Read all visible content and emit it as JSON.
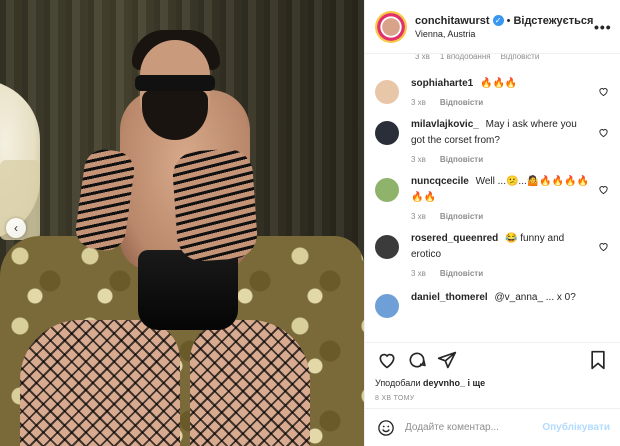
{
  "header": {
    "username": "conchitawurst",
    "separator": "•",
    "follow_status": "Відстежується",
    "location": "Vienna, Austria",
    "more_label": "•••"
  },
  "partial_row": {
    "time": "3 хв",
    "likes": "1 вподобання",
    "reply": "Відповісти"
  },
  "comments": [
    {
      "user": "sophiaharte1",
      "text": "🔥🔥🔥",
      "time": "3 хв",
      "reply": "Відповісти",
      "avatar_color": "#e8c6a8"
    },
    {
      "user": "milavlajkovic_",
      "text": "May i ask where you got the corset from?",
      "time": "3 хв",
      "reply": "Відповісти",
      "avatar_color": "#2a2e38"
    },
    {
      "user": "nuncqcecile",
      "text": "Well ...😕...🤷🔥🔥🔥🔥🔥🔥",
      "time": "3 хв",
      "reply": "Відповісти",
      "avatar_color": "#8fb36a"
    },
    {
      "user": "rosered_queenred",
      "text": "😂 funny and erotico",
      "time": "3 хв",
      "reply": "Відповісти",
      "avatar_color": "#3b3b3b"
    }
  ],
  "partial_comment": {
    "user": "daniel_thomerel",
    "text": "@v_anna_ ... x 0?",
    "avatar_color": "#6e9fd6"
  },
  "likes": {
    "prefix": "Уподобали",
    "user": "deyvnho_",
    "suffix": "і ще"
  },
  "time_ago": "8 хв тому",
  "add_comment": {
    "placeholder": "Додайте коментар...",
    "post_label": "Опублікувати"
  },
  "photo": {
    "prev_label": "‹"
  },
  "colors": {
    "verified": "#3897f0",
    "muted": "#8e8e8e",
    "post_disabled": "#b3dbff"
  }
}
